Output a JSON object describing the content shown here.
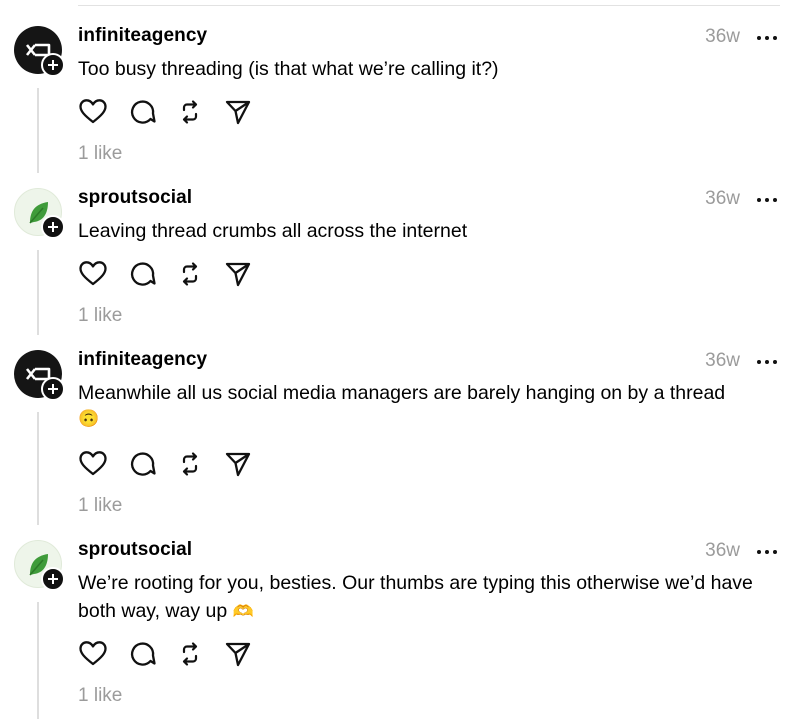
{
  "posts": [
    {
      "username": "infiniteagency",
      "avatar": "infiniteagency-logo",
      "time": "36w",
      "text": "Too busy threading (is that what we’re calling it?)",
      "emoji": "",
      "likes": "1 like"
    },
    {
      "username": "sproutsocial",
      "avatar": "sproutsocial-leaf-logo",
      "time": "36w",
      "text": "Leaving thread crumbs all across the internet",
      "emoji": "",
      "likes": "1 like"
    },
    {
      "username": "infiniteagency",
      "avatar": "infiniteagency-logo",
      "time": "36w",
      "text": "Meanwhile all us social media managers are barely hanging on by a thread",
      "emoji": "🙃",
      "likes": "1 like"
    },
    {
      "username": "sproutsocial",
      "avatar": "sproutsocial-leaf-logo",
      "time": "36w",
      "text": "We’re rooting for you, besties. Our thumbs are typing this otherwise we’d have both way, way up",
      "emoji": "🫶",
      "likes": "1 like"
    }
  ],
  "icons": {
    "like": "heart-icon",
    "reply": "comment-bubble-icon",
    "repost": "repost-arrows-icon",
    "share": "send-paper-plane-icon",
    "more": "more-options-icon"
  },
  "colors": {
    "text": "#000000",
    "muted": "#9b9b9b",
    "thread_line": "#dedede",
    "sprout_green": "#3f9b3a"
  }
}
